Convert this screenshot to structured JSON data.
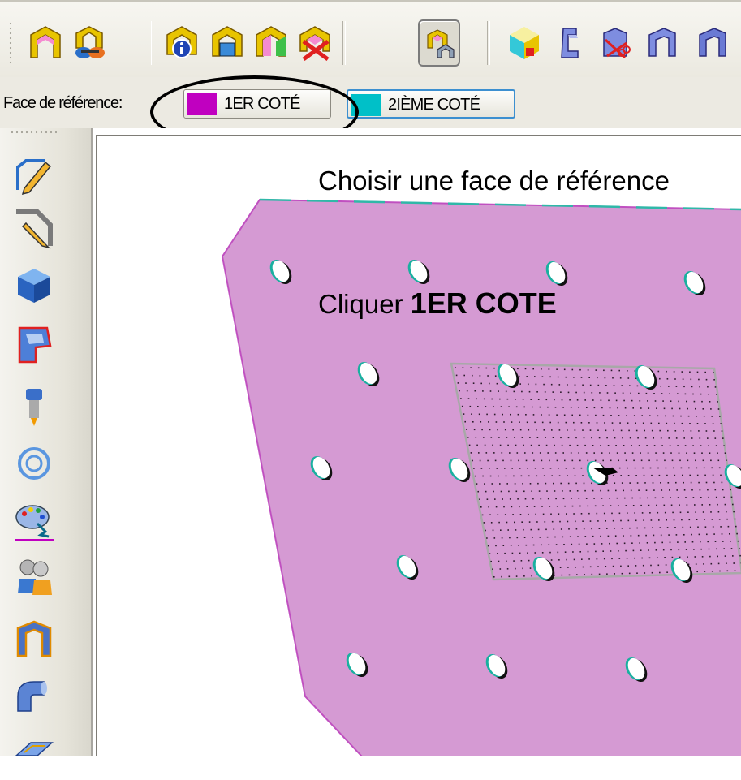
{
  "face_bar": {
    "label": "Face de référence:",
    "side1": {
      "label": "1ER COTÉ",
      "color": "#c000c0"
    },
    "side2": {
      "label": "2IÈME COTÉ",
      "color": "#00c0c8"
    }
  },
  "viewport": {
    "instruction_choose": "Choisir une face de référence",
    "instruction_click_prefix": "Cliquer",
    "instruction_click_target": "1ER COTE",
    "plate_color": "#d59ad3",
    "plate_edge_color": "#c050c0"
  },
  "toolbar_icons": [
    "unfold-icon",
    "unfold-view-icon",
    "sheet-info-icon",
    "bend-edit-icon",
    "bend-add-icon",
    "bend-delete-icon",
    "reference-face-icon",
    "solid-face-icon",
    "flange-icon",
    "cut-corner-icon",
    "corner-relief-icon"
  ],
  "sidebar_icons": [
    "sketch-pencil-icon",
    "profile-pencil-icon",
    "box-icon",
    "transition-icon",
    "punch-tool-icon",
    "hole-circle-icon",
    "color-palette-icon",
    "users-icon",
    "flange-icon",
    "elbow-icon",
    "tab-icon"
  ]
}
